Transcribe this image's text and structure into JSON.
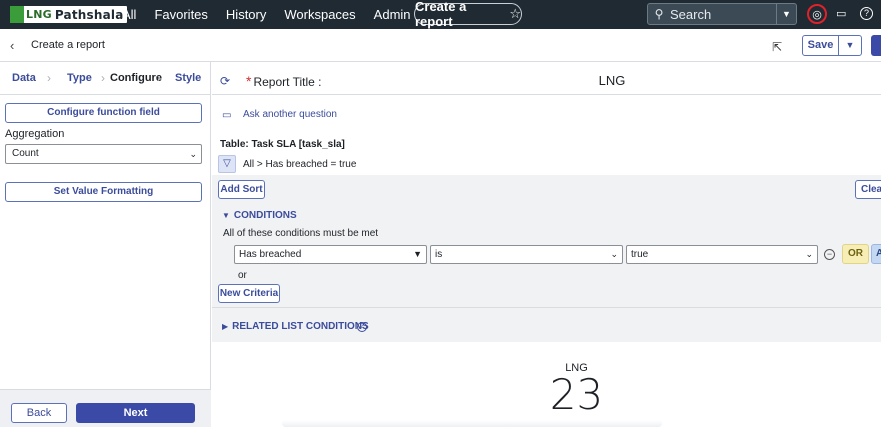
{
  "topnav": {
    "logo_lng": "LNG",
    "logo_text": "Pathshala",
    "links": [
      "All",
      "Favorites",
      "History",
      "Workspaces",
      "Admin"
    ],
    "create_pill": "Create a report",
    "search_placeholder": "Search"
  },
  "header": {
    "crumb": "Create a report",
    "save_label": "Save"
  },
  "steps": [
    "Data",
    "Type",
    "Configure",
    "Style"
  ],
  "left": {
    "configure_function_field": "Configure function field",
    "aggregation_label": "Aggregation",
    "aggregation_value": "Count",
    "set_value_formatting": "Set Value Formatting",
    "back_label": "Back",
    "next_label": "Next"
  },
  "right": {
    "report_title_label": "Report Title :",
    "report_title_value": "LNG",
    "ask_another": "Ask another question",
    "table_name": "Table: Task SLA [task_sla]",
    "breadcrumb": "All  >  Has breached = true",
    "add_sort": "Add Sort",
    "clear": "Clear",
    "conditions_header": "CONDITIONS",
    "all_met": "All of these conditions must be met",
    "condition": {
      "field": "Has breached",
      "operator": "is",
      "value": "true"
    },
    "or_button": "OR",
    "and_button": "A",
    "or_text": "or",
    "new_criteria": "New Criteria",
    "related_header": "RELATED LIST CONDITIONS",
    "preview_title": "LNG",
    "preview_value": "23"
  }
}
